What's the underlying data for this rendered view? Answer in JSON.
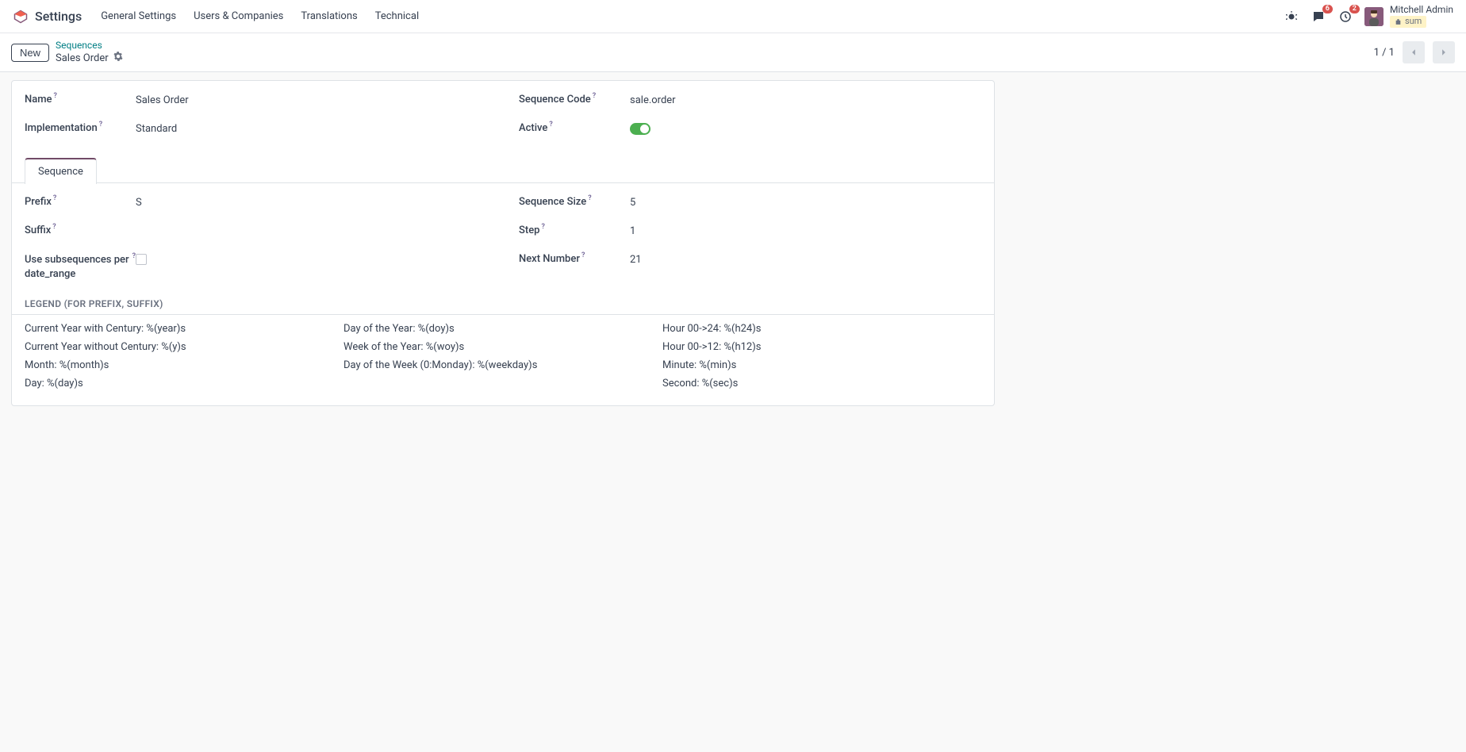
{
  "nav": {
    "app_title": "Settings",
    "menu": [
      "General Settings",
      "Users & Companies",
      "Translations",
      "Technical"
    ],
    "messages_badge": "6",
    "activities_badge": "2",
    "user_name": "Mitchell Admin",
    "user_company": "sum"
  },
  "cp": {
    "new_label": "New",
    "breadcrumb_parent": "Sequences",
    "breadcrumb_current": "Sales Order",
    "pager": "1 / 1"
  },
  "form": {
    "left": {
      "name_label": "Name",
      "name_value": "Sales Order",
      "impl_label": "Implementation",
      "impl_value": "Standard"
    },
    "right": {
      "code_label": "Sequence Code",
      "code_value": "sale.order",
      "active_label": "Active"
    }
  },
  "tab_label": "Sequence",
  "seq": {
    "left": {
      "prefix_label": "Prefix",
      "prefix_value": "S",
      "suffix_label": "Suffix",
      "suffix_value": "",
      "subseq_label": "Use subsequences per date_range"
    },
    "right": {
      "size_label": "Sequence Size",
      "size_value": "5",
      "step_label": "Step",
      "step_value": "1",
      "next_label": "Next Number",
      "next_value": "21"
    }
  },
  "legend": {
    "title": "LEGEND (FOR PREFIX, SUFFIX)",
    "col1": [
      "Current Year with Century: %(year)s",
      "Current Year without Century: %(y)s",
      "Month: %(month)s",
      "Day: %(day)s"
    ],
    "col2": [
      "Day of the Year: %(doy)s",
      "Week of the Year: %(woy)s",
      "Day of the Week (0:Monday): %(weekday)s"
    ],
    "col3": [
      "Hour 00->24: %(h24)s",
      "Hour 00->12: %(h12)s",
      "Minute: %(min)s",
      "Second: %(sec)s"
    ]
  }
}
